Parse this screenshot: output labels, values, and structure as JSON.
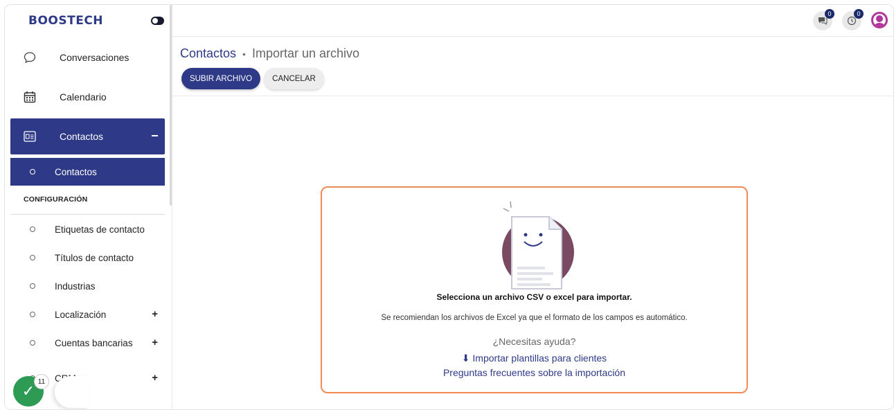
{
  "brand": {
    "name": "BOOSTECH"
  },
  "sidebar": {
    "items": [
      {
        "label": "Conversaciones",
        "icon": "chat-bubble-icon"
      },
      {
        "label": "Calendario",
        "icon": "calendar-icon"
      },
      {
        "label": "Contactos",
        "icon": "contact-card-icon",
        "expanded": true
      }
    ],
    "active_sub": {
      "label": "Contactos"
    },
    "section_header": "CONFIGURACIÓN",
    "config_items": [
      {
        "label": "Etiquetas de contacto"
      },
      {
        "label": "Títulos de contacto"
      },
      {
        "label": "Industrias"
      },
      {
        "label": "Localización"
      },
      {
        "label": "Cuentas bancarias"
      },
      {
        "label": "CRM"
      }
    ],
    "task_count": "11"
  },
  "topbar": {
    "messages_count": "0",
    "history_count": "0"
  },
  "header": {
    "breadcrumb_root": "Contactos",
    "breadcrumb_separator": "•",
    "breadcrumb_current": "Importar un archivo",
    "upload_button": "SUBIR ARCHIVO",
    "cancel_button": "CANCELAR"
  },
  "upload_card": {
    "title": "Selecciona un archivo CSV o excel para importar.",
    "description": "Se recomiendan los archivos de Excel ya que el formato de los campos es automático.",
    "help_text": "¿Necesitas ayuda?",
    "import_templates_link": "Importar plantillas para clientes",
    "faq_link": "Preguntas frecuentes sobre la importación"
  },
  "colors": {
    "primary": "#2e3a87",
    "card_border": "#f08a55",
    "success": "#2e9b55",
    "avatar": "#b2359a",
    "illustration_circle": "#7a4a63"
  }
}
